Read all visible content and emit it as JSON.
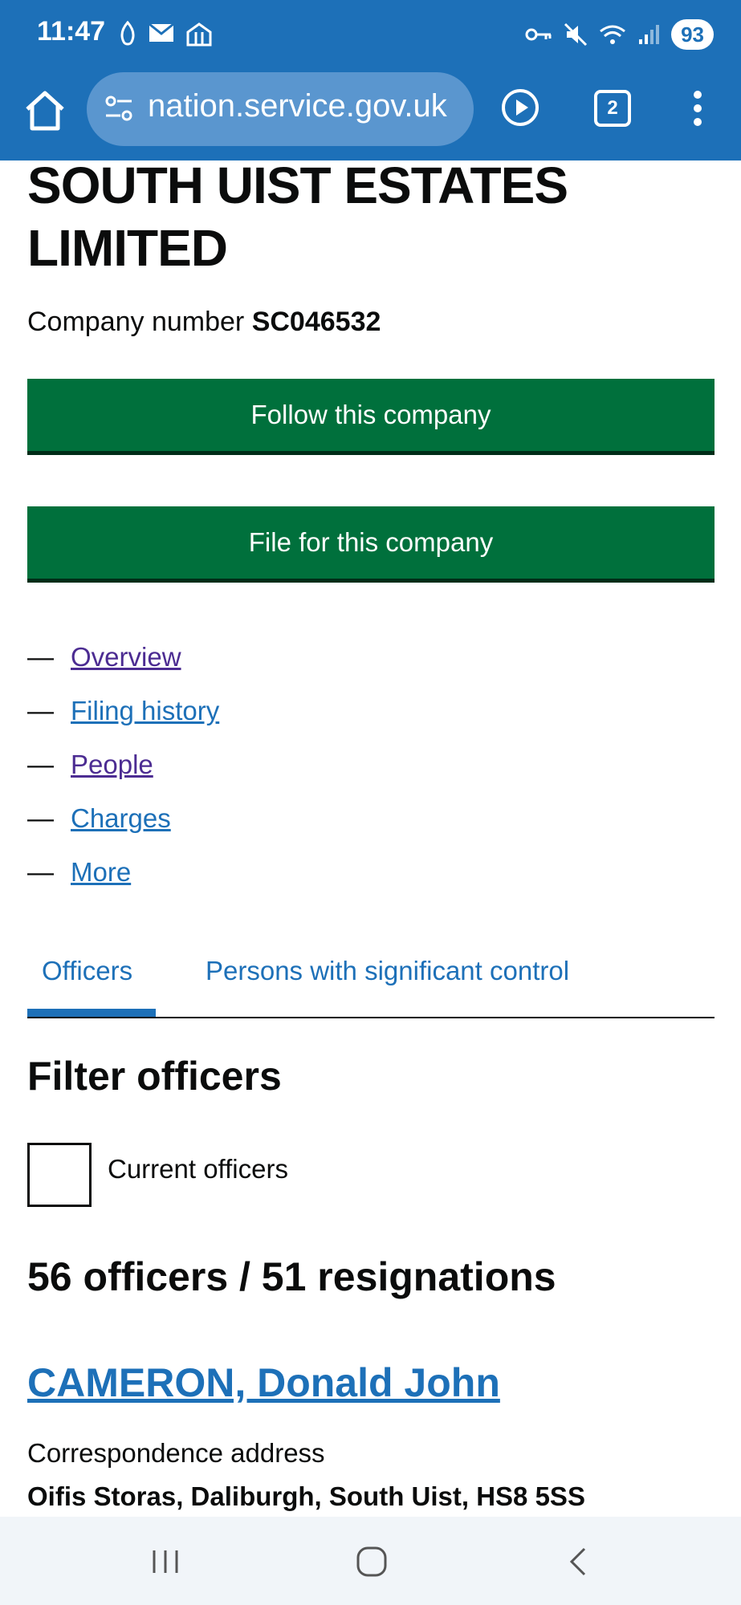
{
  "status_bar": {
    "time": "11:47",
    "left_icons": [
      "app-icon",
      "mail-icon",
      "food-icon"
    ],
    "right_icons": [
      "vpn-key-icon",
      "mute-icon",
      "wifi-icon",
      "signal-icon"
    ],
    "battery": "93"
  },
  "browser": {
    "url": "nation.service.gov.uk",
    "tab_count": "2"
  },
  "company": {
    "title": "SOUTH UIST ESTATES LIMITED",
    "number_label": "Company number",
    "number": "SC046532"
  },
  "actions": {
    "follow": "Follow this company",
    "file": "File for this company"
  },
  "nav": {
    "items": [
      {
        "label": "Overview",
        "visited": true
      },
      {
        "label": "Filing history",
        "visited": false
      },
      {
        "label": "People",
        "visited": true
      },
      {
        "label": "Charges",
        "visited": false
      },
      {
        "label": "More",
        "visited": false
      }
    ],
    "dash": "—"
  },
  "tabs": {
    "officers": "Officers",
    "psc": "Persons with significant control"
  },
  "filter": {
    "heading": "Filter officers",
    "current_label": "Current officers"
  },
  "counts": {
    "heading": "56 officers / 51 resignations"
  },
  "officer": {
    "name": "CAMERON, Donald John",
    "address_label": "Correspondence address",
    "address": "Oifis Storas, Daliburgh, South Uist, HS8 5SS"
  },
  "colors": {
    "brand_blue": "#1d70b8",
    "button_green": "#00703c",
    "visited_link": "#4c2c92"
  }
}
